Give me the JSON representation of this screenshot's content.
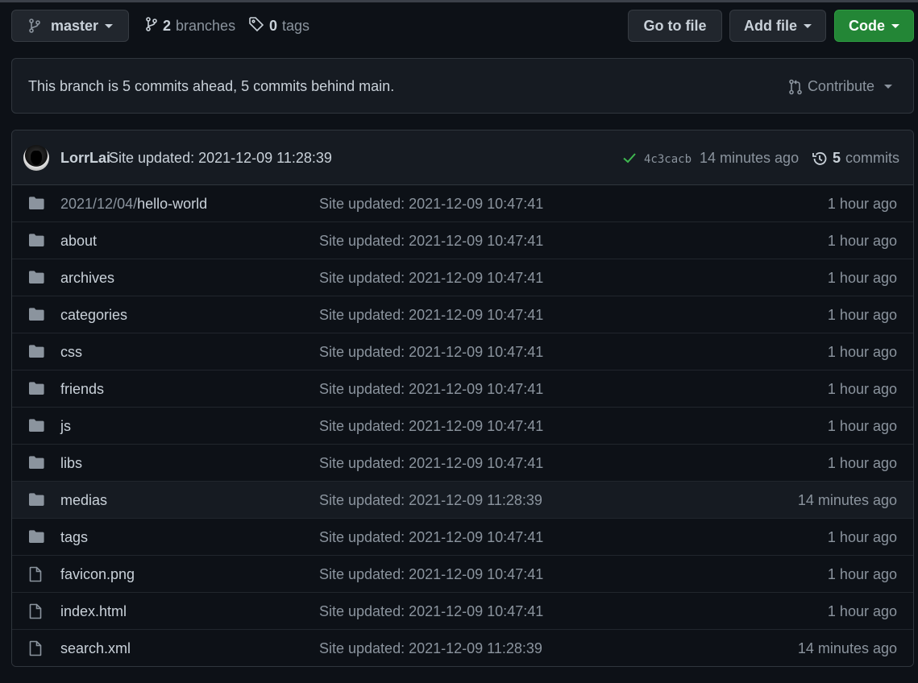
{
  "toolbar": {
    "branch_name": "master",
    "branches_count": "2",
    "branches_label": "branches",
    "tags_count": "0",
    "tags_label": "tags",
    "goto_label": "Go to file",
    "add_file_label": "Add file",
    "code_label": "Code"
  },
  "branch_info": {
    "message": "This branch is 5 commits ahead, 5 commits behind main.",
    "contribute_label": "Contribute"
  },
  "latest_commit": {
    "author": "LorrLai",
    "message": "Site updated: 2021-12-09 11:28:39",
    "sha": "4c3cacb",
    "time": "14 minutes ago",
    "commits_count": "5",
    "commits_label": "commits"
  },
  "files": [
    {
      "type": "folder",
      "prefix": "2021/12/04/",
      "name": "hello-world",
      "message": "Site updated: 2021-12-09 10:47:41",
      "age": "1 hour ago"
    },
    {
      "type": "folder",
      "prefix": "",
      "name": "about",
      "message": "Site updated: 2021-12-09 10:47:41",
      "age": "1 hour ago"
    },
    {
      "type": "folder",
      "prefix": "",
      "name": "archives",
      "message": "Site updated: 2021-12-09 10:47:41",
      "age": "1 hour ago"
    },
    {
      "type": "folder",
      "prefix": "",
      "name": "categories",
      "message": "Site updated: 2021-12-09 10:47:41",
      "age": "1 hour ago"
    },
    {
      "type": "folder",
      "prefix": "",
      "name": "css",
      "message": "Site updated: 2021-12-09 10:47:41",
      "age": "1 hour ago"
    },
    {
      "type": "folder",
      "prefix": "",
      "name": "friends",
      "message": "Site updated: 2021-12-09 10:47:41",
      "age": "1 hour ago"
    },
    {
      "type": "folder",
      "prefix": "",
      "name": "js",
      "message": "Site updated: 2021-12-09 10:47:41",
      "age": "1 hour ago"
    },
    {
      "type": "folder",
      "prefix": "",
      "name": "libs",
      "message": "Site updated: 2021-12-09 10:47:41",
      "age": "1 hour ago"
    },
    {
      "type": "folder",
      "prefix": "",
      "name": "medias",
      "message": "Site updated: 2021-12-09 11:28:39",
      "age": "14 minutes ago"
    },
    {
      "type": "folder",
      "prefix": "",
      "name": "tags",
      "message": "Site updated: 2021-12-09 10:47:41",
      "age": "1 hour ago"
    },
    {
      "type": "file",
      "prefix": "",
      "name": "favicon.png",
      "message": "Site updated: 2021-12-09 10:47:41",
      "age": "1 hour ago"
    },
    {
      "type": "file",
      "prefix": "",
      "name": "index.html",
      "message": "Site updated: 2021-12-09 10:47:41",
      "age": "1 hour ago"
    },
    {
      "type": "file",
      "prefix": "",
      "name": "search.xml",
      "message": "Site updated: 2021-12-09 11:28:39",
      "age": "14 minutes ago"
    }
  ],
  "colors": {
    "background": "#0d1117",
    "accent_green": "#238636",
    "check_green": "#3fb950",
    "muted_text": "#8b949e",
    "folder_icon": "#8b949e"
  }
}
